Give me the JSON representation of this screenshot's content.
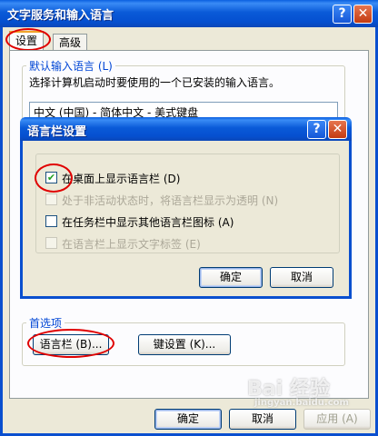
{
  "outer_window": {
    "title": "文字服务和输入语言",
    "help_label": "?",
    "close_label": "✕"
  },
  "tabs": [
    {
      "label": "设置",
      "active": true
    },
    {
      "label": "高级",
      "active": false
    }
  ],
  "default_language": {
    "label": "默认输入语言 (L)",
    "description": "选择计算机启动时要使用的一个已安装的输入语言。",
    "selected_value": "中文 (中国) - 简体中文 - 美式键盘"
  },
  "preferences": {
    "label": "首选项",
    "language_bar_button": "语言栏 (B)...",
    "key_settings_button": "键设置 (K)..."
  },
  "footer": {
    "ok": "确定",
    "cancel": "取消",
    "apply": "应用 (A)"
  },
  "language_bar_dialog": {
    "title": "语言栏设置",
    "help_label": "?",
    "close_label": "✕",
    "options": [
      {
        "label": "在桌面上显示语言栏 (D)",
        "checked": true,
        "enabled": true
      },
      {
        "label": "处于非活动状态时，将语言栏显示为透明 (N)",
        "checked": false,
        "enabled": false
      },
      {
        "label": "在任务栏中显示其他语言栏图标 (A)",
        "checked": false,
        "enabled": true
      },
      {
        "label": "在语言栏上显示文字标签 (E)",
        "checked": false,
        "enabled": false
      }
    ],
    "ok": "确定",
    "cancel": "取消"
  },
  "watermark": {
    "brand": "Bai 经验",
    "url": "jingyan.baidu.com"
  },
  "colors": {
    "title_bar": "#0a5ad8",
    "annotation_red": "#e00000",
    "group_label_blue": "#0046d5"
  }
}
